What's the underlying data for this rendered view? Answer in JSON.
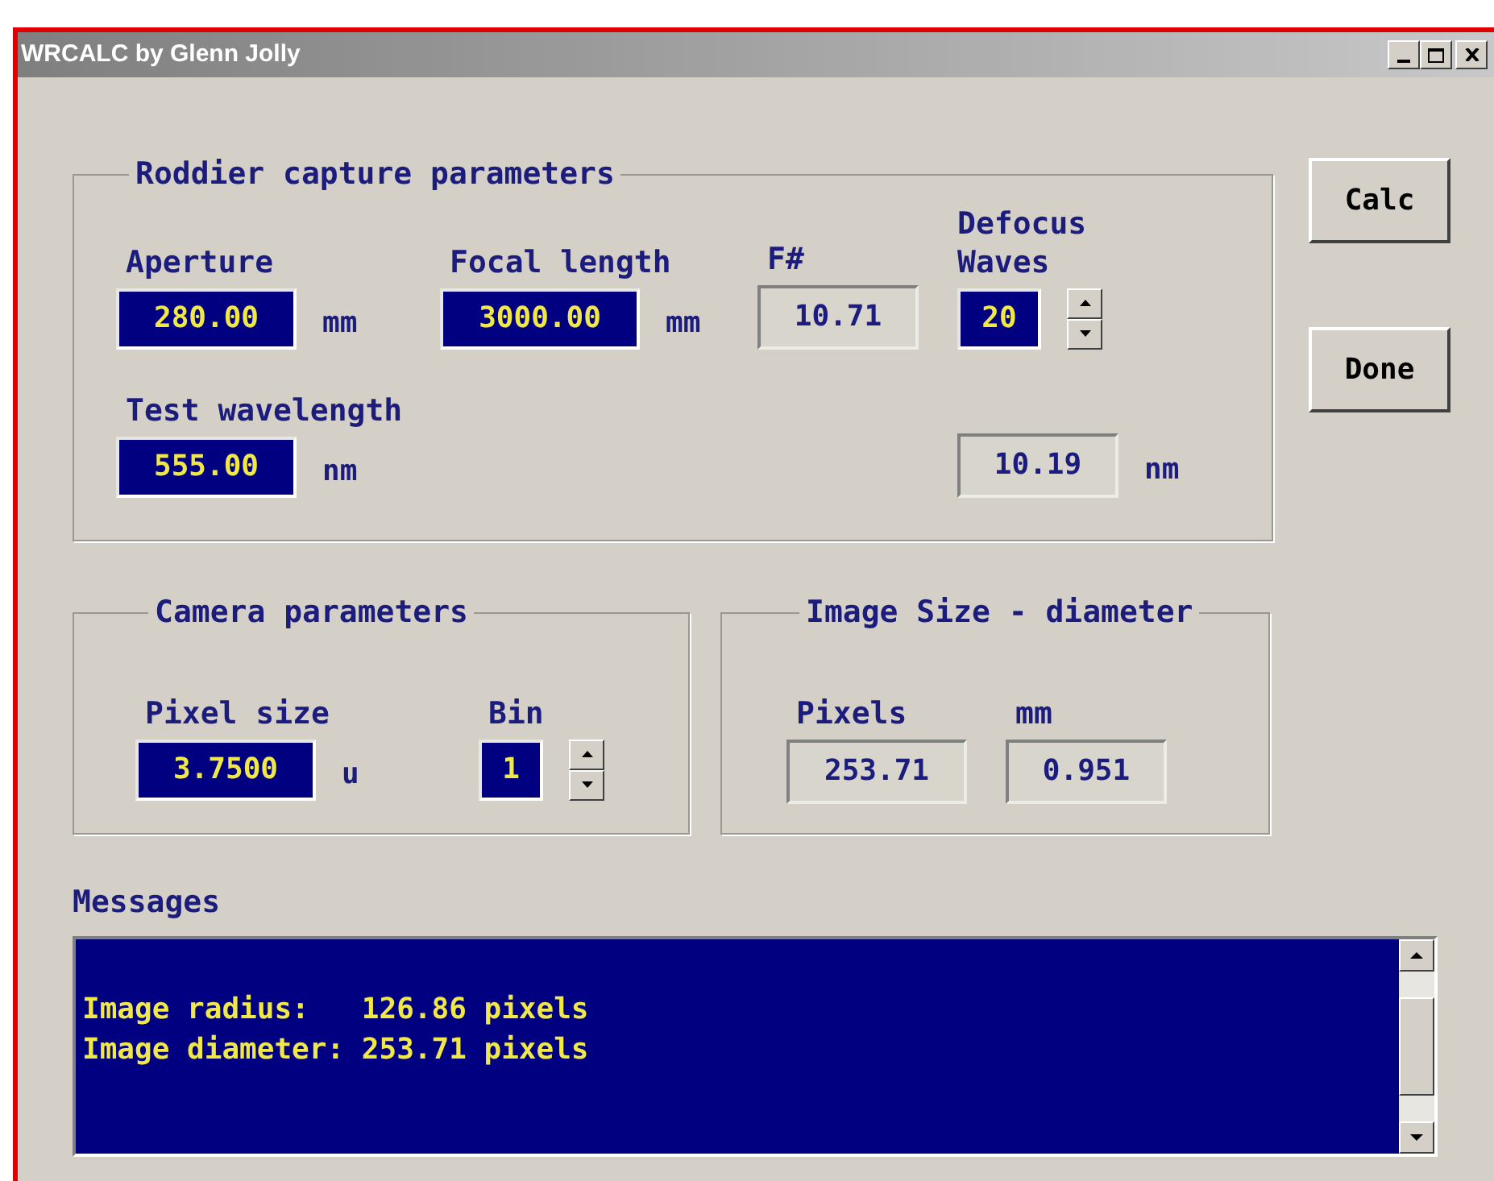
{
  "window": {
    "title": "WRCALC by Glenn Jolly"
  },
  "roddier": {
    "legend": "Roddier capture parameters",
    "fields": [
      {
        "kind": "input",
        "label": "Aperture",
        "value": "280.00",
        "unit": "mm"
      },
      {
        "kind": "input",
        "label": "Focal length",
        "value": "3000.00",
        "unit": "mm"
      },
      {
        "kind": "output",
        "label": "F#",
        "value": "10.71"
      },
      {
        "kind": "spin",
        "label": "Defocus Waves",
        "value": "20"
      }
    ],
    "wavelength": {
      "kind": "input",
      "label": "Test wavelength",
      "value": "555.00",
      "unit": "nm"
    },
    "defocus_result": {
      "kind": "output",
      "value": "10.19",
      "unit": "nm"
    }
  },
  "buttons": [
    "Calc",
    "Done"
  ],
  "camera": {
    "legend": "Camera parameters",
    "fields": [
      {
        "kind": "input",
        "label": "Pixel size",
        "value": "3.7500",
        "unit": "u"
      },
      {
        "kind": "spin",
        "label": "Bin",
        "value": "1"
      }
    ]
  },
  "image_size": {
    "legend": "Image Size - diameter",
    "fields": [
      {
        "kind": "output",
        "label": "Pixels",
        "value": "253.71"
      },
      {
        "kind": "output",
        "label": "mm",
        "value": "0.951"
      }
    ]
  },
  "messages": {
    "label": "Messages",
    "lines": [
      "Image radius:   126.86 pixels",
      "Image diameter: 253.71 pixels"
    ]
  }
}
